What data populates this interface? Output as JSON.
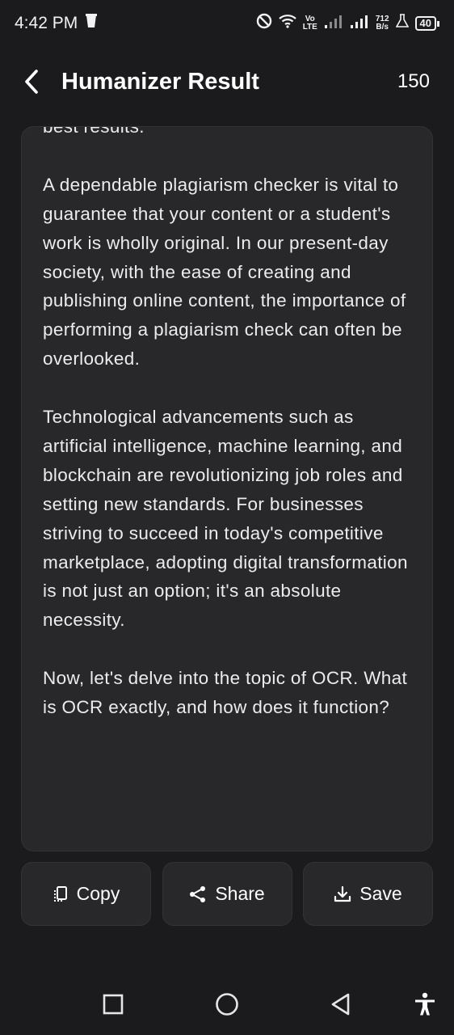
{
  "status_bar": {
    "time": "4:42 PM",
    "net_speed_top": "712",
    "net_speed_bottom": "B/s",
    "volte_top": "Vo",
    "volte_bottom": "LTE",
    "battery": "40",
    "icons": [
      "trash-icon",
      "dnd-icon",
      "wifi-icon",
      "signal-icon",
      "signal-icon",
      "flask-icon",
      "battery-icon"
    ]
  },
  "app_bar": {
    "title": "Humanizer Result",
    "count": "150"
  },
  "result": {
    "paragraphs": [
      "best results.",
      "A dependable plagiarism checker is vital to guarantee that your content or a student's work is wholly original. In our present-day society, with the ease of creating and publishing online content, the importance of performing a plagiarism check can often be overlooked.",
      "Technological advancements such as artificial intelligence, machine learning, and blockchain are revolutionizing job roles and setting new standards. For businesses striving to succeed in today's competitive marketplace, adopting digital transformation is not just an option; it's an absolute necessity.",
      "Now, let's delve into the topic of OCR. What is OCR exactly, and how does it function?"
    ]
  },
  "actions": {
    "copy_label": "Copy",
    "share_label": "Share",
    "save_label": "Save"
  },
  "nav": {
    "icons": [
      "recents-icon",
      "home-icon",
      "back-icon",
      "accessibility-icon"
    ]
  }
}
